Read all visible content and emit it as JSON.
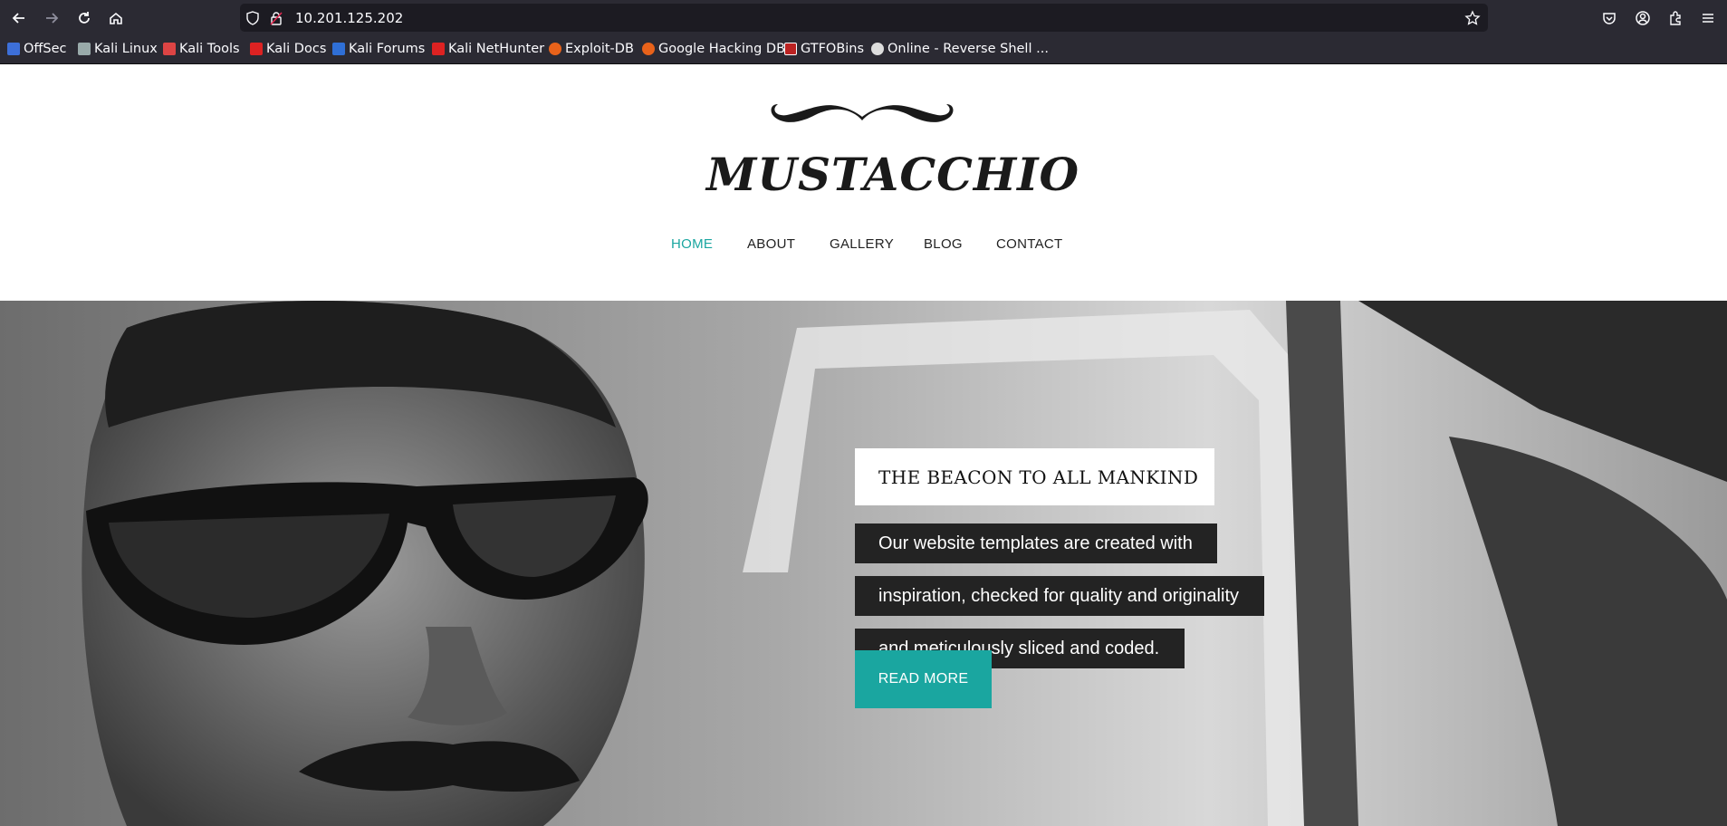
{
  "browser": {
    "url": "10.201.125.202",
    "bookmarks": [
      {
        "label": "OffSec",
        "icon": "offsec-icon",
        "color": "#3d6fd8"
      },
      {
        "label": "Kali Linux",
        "icon": "kali-dragon-icon",
        "color": "#9aa"
      },
      {
        "label": "Kali Tools",
        "icon": "kali-tools-icon",
        "color": "#d44"
      },
      {
        "label": "Kali Docs",
        "icon": "kali-docs-icon",
        "color": "#d22"
      },
      {
        "label": "Kali Forums",
        "icon": "kali-forums-icon",
        "color": "#2f6fd6"
      },
      {
        "label": "Kali NetHunter",
        "icon": "nethunter-icon",
        "color": "#d22"
      },
      {
        "label": "Exploit-DB",
        "icon": "exploitdb-icon",
        "color": "#e8621a"
      },
      {
        "label": "Google Hacking DB",
        "icon": "ghdb-icon",
        "color": "#e8621a"
      },
      {
        "label": "GTFOBins",
        "icon": "gtfobins-icon",
        "color": "#b22"
      },
      {
        "label": "Online - Reverse Shell ...",
        "icon": "skull-icon",
        "color": "#ddd"
      }
    ]
  },
  "site": {
    "logo_text": "MUSTACCHIO",
    "nav": [
      "HOME",
      "ABOUT",
      "GALLERY",
      "BLOG",
      "CONTACT"
    ],
    "active_nav": "HOME",
    "accent": "#1aa6a0",
    "hero": {
      "title": "THE BEACON TO ALL MANKIND",
      "lines": [
        "Our website templates are created with",
        "inspiration, checked for quality and originality",
        "and meticulously sliced and coded."
      ],
      "button": "READ MORE"
    }
  }
}
